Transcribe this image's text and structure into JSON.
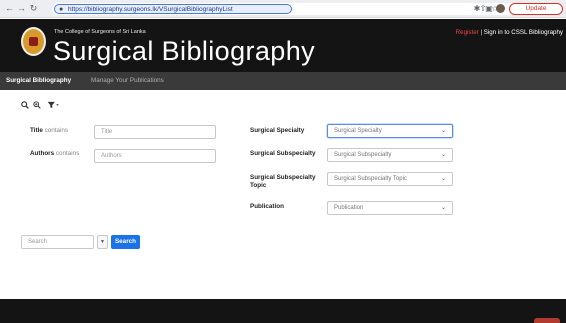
{
  "browser": {
    "url": "https://bibliography.surgeons.lk/VSurgicalBibliographyList",
    "update_label": "Update"
  },
  "header": {
    "org_name": "The College of Surgeons of Sri Lanka",
    "title": "Surgical Bibliography",
    "register_label": "Register",
    "separator": " | ",
    "signin_label": "Sign in to CSSL Bibliography"
  },
  "nav": {
    "active": "Surgical Bibliography",
    "manage": "Manage Your Publications"
  },
  "toolbar": {
    "search_icon": "search-icon",
    "zoom_icon": "search-plus-icon",
    "filter_icon": "filter-icon"
  },
  "form": {
    "title": {
      "label_strong": "Title",
      "label_muted": " contains",
      "placeholder": "Title"
    },
    "authors": {
      "label_strong": "Authors",
      "label_muted": " contains",
      "placeholder": "Authors"
    },
    "specialty": {
      "label": "Surgical Specialty",
      "placeholder": "Surgical Specialty"
    },
    "subspecialty": {
      "label": "Surgical Subspecialty",
      "placeholder": "Surgical Subspecialty"
    },
    "subspecialty_topic": {
      "label_line1": "Surgical Subspecialty",
      "label_line2": "Topic",
      "placeholder": "Surgical Subspecialty Topic"
    },
    "publication": {
      "label": "Publication",
      "placeholder": "Publication"
    }
  },
  "search": {
    "placeholder": "Search",
    "button_label": "Search"
  },
  "colors": {
    "header_bg": "#141414",
    "nav_bg": "#3a3a3a",
    "accent_blue": "#1a73e8",
    "register_red": "#e8464a"
  }
}
